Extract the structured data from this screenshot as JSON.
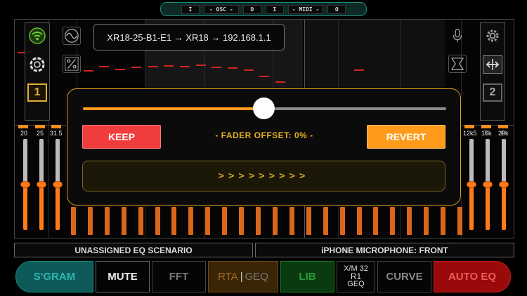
{
  "status": {
    "segments": [
      "I",
      "- OSC -",
      "O",
      "I",
      "- MIDI -",
      "O"
    ]
  },
  "connection": {
    "text": "XR18-25-B1-E1 → XR18 → 192.168.1.1"
  },
  "left_controls": {
    "number": "1"
  },
  "right_controls": {
    "number": "2"
  },
  "frequency_labels": {
    "left": [
      "20",
      "25",
      "31.5"
    ],
    "right": [
      "12k5",
      "16k",
      "20k"
    ]
  },
  "fader_offset_dialog": {
    "slider_value_fraction": 0.5,
    "keep_label": "KEEP",
    "revert_label": "REVERT",
    "offset_text": "- FADER OFFSET: 0% -",
    "swipe_text": ">>>>>>>>>"
  },
  "info": {
    "left": "UNASSIGNED EQ SCENARIO",
    "right": "iPHONE MICROPHONE: FRONT"
  },
  "toolbar": {
    "sgram": "S'GRAM",
    "mute": "MUTE",
    "fft": "FFT",
    "rta": "RTA",
    "rta_sep": "|",
    "geq": "GEQ",
    "lib": "LIB",
    "mixer_line1": "X/M 32",
    "mixer_line2": "R1",
    "mixer_line3": "GEQ",
    "curve": "CURVE",
    "auto_eq": "AUTO EQ"
  },
  "colors": {
    "accent_orange": "#ff9a1a",
    "keep_red": "#f03c3c",
    "dialog_border": "#e0a020",
    "sgram_teal": "#0e5a58",
    "lib_green": "#0a3a10",
    "auto_eq_red": "#9a0a0a"
  },
  "icons": {
    "wifi": "wifi-icon",
    "lifebuoy": "lifebuoy-icon",
    "sine": "sine-wave-icon",
    "percent": "percent-icon",
    "microphone": "microphone-icon",
    "gear": "gear-icon",
    "expand": "expand-icon",
    "flip": "flip-icon"
  }
}
